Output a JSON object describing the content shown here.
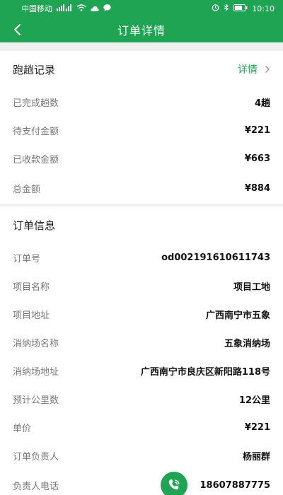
{
  "status_bar": {
    "carrier": "中国移动",
    "time": "10:10"
  },
  "nav": {
    "title": "订单详情",
    "back_icon": "chevron-left-icon"
  },
  "trip_record": {
    "title": "跑趟记录",
    "detail_label": "详情",
    "rows": [
      {
        "label": "已完成趟数",
        "value": "4趟"
      },
      {
        "label": "待支付金额",
        "value": "¥221"
      },
      {
        "label": "已收款金额",
        "value": "¥663"
      },
      {
        "label": "总金额",
        "value": "¥884"
      }
    ]
  },
  "order_info": {
    "title": "订单信息",
    "rows": [
      {
        "label": "订单号",
        "value": "od002191610611743"
      },
      {
        "label": "项目名称",
        "value": "项目工地"
      },
      {
        "label": "项目地址",
        "value": "广西南宁市五象"
      },
      {
        "label": "消纳场名称",
        "value": "五象消纳场"
      },
      {
        "label": "消纳场地址",
        "value": "广西南宁市良庆区新阳路118号"
      },
      {
        "label": "预计公里数",
        "value": "12公里"
      },
      {
        "label": "单价",
        "value": "¥221"
      },
      {
        "label": "订单负责人",
        "value": "杨丽群"
      }
    ],
    "phone_row": {
      "label": "负责人电话",
      "value": "18607887775"
    }
  },
  "colors": {
    "brand_green": "#1ea453",
    "background": "#f1f1f1"
  }
}
